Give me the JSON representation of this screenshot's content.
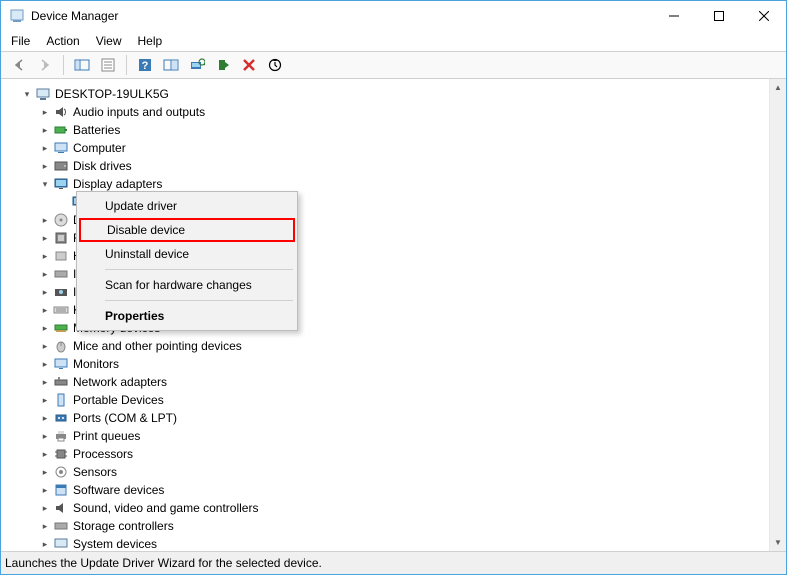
{
  "title": "Device Manager",
  "menu": {
    "file": "File",
    "action": "Action",
    "view": "View",
    "help": "Help"
  },
  "root": "DESKTOP-19ULK5G",
  "categories": [
    {
      "label": "Audio inputs and outputs"
    },
    {
      "label": "Batteries"
    },
    {
      "label": "Computer"
    },
    {
      "label": "Disk drives"
    },
    {
      "label": "Display adapters",
      "expanded": true
    },
    {
      "label": "D"
    },
    {
      "label": "F"
    },
    {
      "label": "H"
    },
    {
      "label": "II"
    },
    {
      "label": "II"
    },
    {
      "label": "K"
    },
    {
      "label": "Memory devices"
    },
    {
      "label": "Mice and other pointing devices"
    },
    {
      "label": "Monitors"
    },
    {
      "label": "Network adapters"
    },
    {
      "label": "Portable Devices"
    },
    {
      "label": "Ports (COM & LPT)"
    },
    {
      "label": "Print queues"
    },
    {
      "label": "Processors"
    },
    {
      "label": "Sensors"
    },
    {
      "label": "Software devices"
    },
    {
      "label": "Sound, video and game controllers"
    },
    {
      "label": "Storage controllers"
    },
    {
      "label": "System devices"
    }
  ],
  "context": {
    "update": "Update driver",
    "disable": "Disable device",
    "uninstall": "Uninstall device",
    "scan": "Scan for hardware changes",
    "props": "Properties"
  },
  "status": "Launches the Update Driver Wizard for the selected device."
}
